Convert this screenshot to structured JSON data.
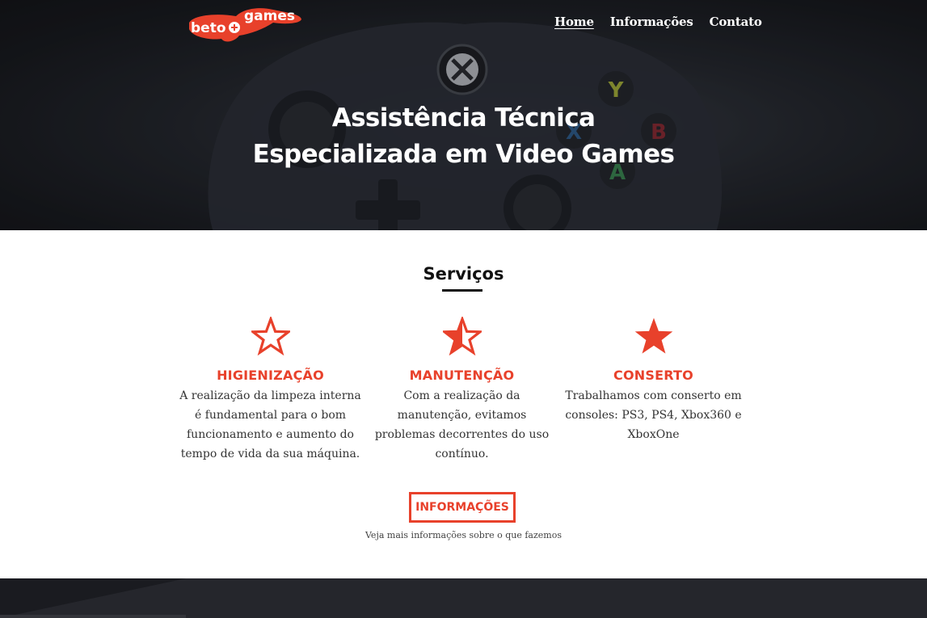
{
  "brand": {
    "logo_text_1": "beto",
    "logo_text_2": "games",
    "accent_color": "#e8412b"
  },
  "nav": {
    "items": [
      {
        "label": "Home",
        "active": true
      },
      {
        "label": "Informações",
        "active": false
      },
      {
        "label": "Contato",
        "active": false
      }
    ]
  },
  "hero": {
    "title_line_1": "Assistência Técnica",
    "title_line_2": "Especializada em Video Games",
    "background": "game-controller-photo"
  },
  "services": {
    "title": "Serviços",
    "cards": [
      {
        "icon": "star-outline-icon",
        "title": "HIGIENIZAÇÃO",
        "text": "A realização da limpeza interna é fundamental para o bom funcionamento e aumento do tempo de vida da sua máquina."
      },
      {
        "icon": "star-half-icon",
        "title": "MANUTENÇÃO",
        "text": "Com a realização da manutenção, evitamos problemas decorrentes do uso contínuo."
      },
      {
        "icon": "star-filled-icon",
        "title": "CONSERTO",
        "text": "Trabalhamos com conserto em consoles: PS3, PS4, Xbox360 e XboxOne"
      }
    ]
  },
  "cta": {
    "button_label": "INFORMAÇÕES",
    "caption": "Veja mais informações sobre o que fazemos"
  }
}
